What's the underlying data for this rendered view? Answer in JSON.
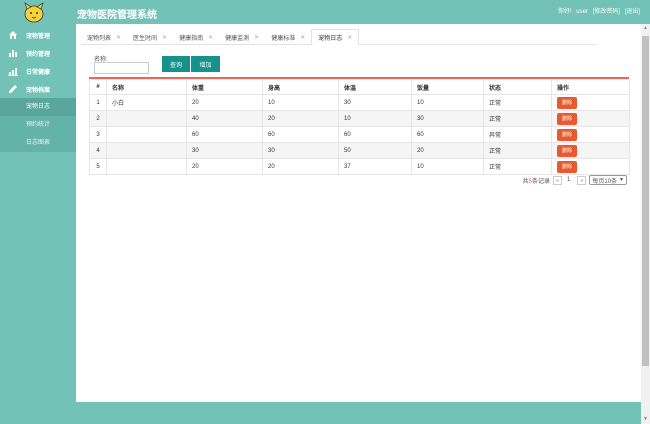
{
  "header": {
    "app_title": "宠物医院管理系统",
    "greeting": "你好!",
    "username": "user",
    "change_password": "[修改密码]",
    "logout": "[退出]"
  },
  "sidebar": {
    "items": [
      {
        "label": "宠物管理",
        "icon": "home-icon"
      },
      {
        "label": "预约管理",
        "icon": "chart-bar-icon"
      },
      {
        "label": "日常健康",
        "icon": "chart-line-icon"
      },
      {
        "label": "宠物档案",
        "icon": "edit-icon"
      }
    ],
    "subitems": [
      {
        "label": "宠物日志"
      },
      {
        "label": "预约统计"
      },
      {
        "label": "日志图表"
      }
    ]
  },
  "tabs": [
    {
      "label": "宠物列表"
    },
    {
      "label": "医生时间"
    },
    {
      "label": "健康指南"
    },
    {
      "label": "健康监测"
    },
    {
      "label": "健康标准"
    },
    {
      "label": "宠物日志"
    }
  ],
  "search": {
    "label": "名称:",
    "value": "",
    "search_button": "查询",
    "add_button": "增加"
  },
  "table": {
    "columns": [
      "#",
      "名称",
      "体重",
      "身高",
      "体温",
      "饭量",
      "状态",
      "操作"
    ],
    "rows": [
      {
        "index": "1",
        "name": "小白",
        "weight": "20",
        "height": "10",
        "temp": "30",
        "food": "10",
        "status": "正常",
        "action": "删除"
      },
      {
        "index": "2",
        "name": "",
        "weight": "40",
        "height": "20",
        "temp": "10",
        "food": "30",
        "status": "正常",
        "action": "删除"
      },
      {
        "index": "3",
        "name": "",
        "weight": "60",
        "height": "60",
        "temp": "60",
        "food": "60",
        "status": "异常",
        "action": "删除"
      },
      {
        "index": "4",
        "name": "",
        "weight": "30",
        "height": "30",
        "temp": "50",
        "food": "20",
        "status": "正常",
        "action": "删除"
      },
      {
        "index": "5",
        "name": "",
        "weight": "20",
        "height": "20",
        "temp": "37",
        "food": "10",
        "status": "正常",
        "action": "删除"
      }
    ]
  },
  "pager": {
    "total_prefix": "共",
    "total_count": "5",
    "total_suffix": "条记录",
    "prev": "«",
    "page": "1",
    "next": "»",
    "page_size": "每页10条"
  },
  "colors": {
    "theme": "#72c2b8",
    "button": "#17928a",
    "delete": "#ea5a2e",
    "accent_line": "#e26a5c"
  }
}
